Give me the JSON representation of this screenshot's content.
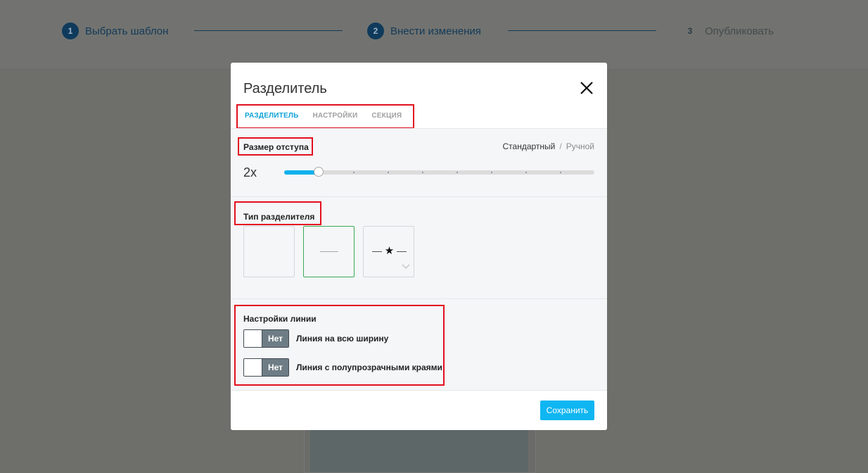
{
  "stepper": {
    "steps": [
      {
        "number": "1",
        "label": "Выбрать шаблон"
      },
      {
        "number": "2",
        "label": "Внести изменения"
      },
      {
        "number": "3",
        "label": "Опубликовать"
      }
    ]
  },
  "modal": {
    "title": "Разделитель",
    "close_icon": "close-icon",
    "tabs": [
      {
        "label": "РАЗДЕЛИТЕЛЬ",
        "active": true
      },
      {
        "label": "НАСТРОЙКИ",
        "active": false
      },
      {
        "label": "СЕКЦИЯ",
        "active": false
      }
    ],
    "padding": {
      "label": "Размер отступа",
      "mode_standard": "Стандартный",
      "mode_separator": "/",
      "mode_manual": "Ручной",
      "value": "2x",
      "slider_level": 0.11,
      "slider_steps": 9
    },
    "divider_type": {
      "label": "Тип разделителя",
      "options": [
        "empty",
        "line",
        "star"
      ],
      "selected": "line"
    },
    "line_settings": {
      "label": "Настройки линии",
      "toggles": [
        {
          "state": "Нет",
          "label": "Линия на всю ширину"
        },
        {
          "state": "Нет",
          "label": "Линия с полупрозрачными краями"
        }
      ]
    },
    "save_label": "Сохранить"
  },
  "colors": {
    "accent": "#0fb6f2",
    "tab_active": "#0fa3d8",
    "highlight_box": "#e2101f",
    "selected_card": "#3aa956",
    "overlay": "#6e6e6b"
  }
}
